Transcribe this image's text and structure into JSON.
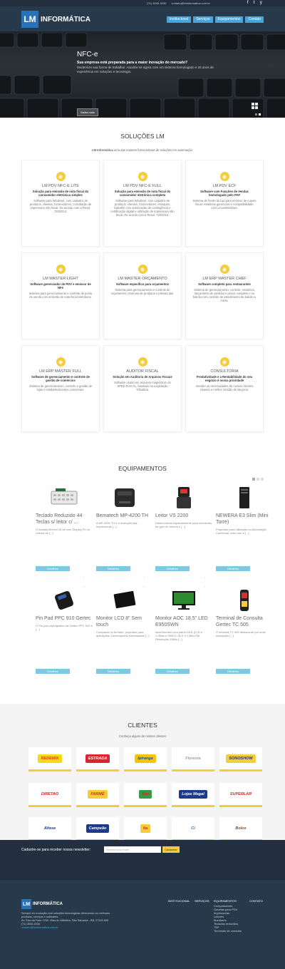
{
  "topbar": {
    "phone": "(71) 3040-4030",
    "email": "contato@lminformatica.com.br",
    "social": [
      "f",
      "t",
      "y"
    ]
  },
  "header": {
    "logo_mark": "LM",
    "logo_text": "INFORMÁTICA",
    "nav": [
      "Institucional",
      "Serviços",
      "Equipamentos",
      "Contato"
    ]
  },
  "hero": {
    "title": "NFC-e",
    "subtitle": "Sua empresa está preparada para a maior inovação do mercado?",
    "text": "Modernize sua forma de trabalhar. Atualize-se agora com um sistema homologado e 25 anos de experiência em soluções e tecnologia.",
    "button": "Saiba mais"
  },
  "solutions": {
    "title": "SOLUÇÕES LM",
    "subtitle_brand": "LM Informática",
    "subtitle_rest": " uma das maiores fornecedoras de soluções em automação.",
    "items": [
      {
        "name": "LM PDV NFC-E LITE",
        "headline": "Solução para emissão de nota fiscal do consumidor eletrônica simples",
        "desc": "Software para Windows, com cadastro de produtos, clientes, fornecedores, conciliação de impressora não fiscal. De acordo com a Resol. 720/2014."
      },
      {
        "name": "LM PDV NFC-E FULL",
        "headline": "Solução para emissão de nota fiscal do consumidor eletrônica completa",
        "desc": "Software para Windows, com cadastro de produtos, clientes, fornecedores, estoques, trabalhe com autorização de contingência e certificação digital e utilização de impressora não fiscal. De acordo com a Resol. 720/2014."
      },
      {
        "name": "LM PDV ECF",
        "headline": "Software com Funções de Vendas homologado pelo PAF",
        "desc": "Sistema de frente de loja para emissor de cupom fiscal, relatórios gerenciais e compatibilidade com Linux/Windows."
      },
      {
        "name": "LM MASTER LIGHT",
        "headline": "Software gerenciador de PDV e emissor de NFe",
        "desc": "Sistema para gerenciamento e controle de ponto de venda com emissão de nota fiscal eletrônica."
      },
      {
        "name": "LM MASTER ORÇAMENTO",
        "headline": "Software específico para orçamentos",
        "desc": "Sistema para gerenciamento e controle de orçamentos, reservas de produtos e prévias das."
      },
      {
        "name": "LM ERP MASTER CHEF",
        "headline": "Software completo para restaurantes",
        "desc": "Sistema de gerenciamento, controle, relatórios, lançamento de pedidos e pesos completo e no balcão com controle de atendimento de balcão e mesa."
      },
      {
        "name": "LM ERP MASTER FULL",
        "headline": "Software de gerenciamento e controle de gestão de comércios",
        "desc": "Sistema de gerenciamento, controle e gestão de lojas e estabelecimentos comerciais."
      },
      {
        "name": "AUDITOR FISCAL",
        "headline": "Solução em Auditoria de Arquivos Fiscais",
        "desc": "Software usado em arquivos magnéticos do SPED FISCAL, baseado na Legislação Tributária."
      },
      {
        "name": "CONSULTORIA",
        "headline": "Produtividade e a Rentabilidade do seu negócio é nossa prioridade",
        "desc": "Atender as necessidades de nossos clientes visando a melhor Gestão de Negócio."
      }
    ]
  },
  "equipment": {
    "title": "EQUIPAMENTOS",
    "button": "Detalhes",
    "items": [
      {
        "name": "Teclado Reduzido 44 Teclas s/ leitor c/ ...",
        "desc": "O teclado flexível 44 de com Display Pb no Leitura de [...]",
        "icon": "keyboard-icon"
      },
      {
        "name": "Bematech MP-4200 TH",
        "desc": "A MP-4200 TH é a evolução das impressoras [...]",
        "icon": "printer-icon"
      },
      {
        "name": "Leitor VS 2200",
        "desc": "Desenvolvido especialmente para checkouts de giro de volume e [...]",
        "icon": "scanner-icon"
      },
      {
        "name": "NEWERA E3 Slim (Mini Torre)",
        "desc": "Projetado para utilização na Automação Comercial, este com a [...]",
        "icon": "tower-icon"
      },
      {
        "name": "Pin Pad PPC 910 Gertec",
        "desc": "O Pin pad criptográfico da Gertec PPC 910 é [...]",
        "icon": "pinpad-icon"
      },
      {
        "name": "Monitor LCD 8\" Sem touch",
        "desc": "Compacto no formato, projetado para aplicações. Desempenho interessante [...]",
        "icon": "monitor-small-icon"
      },
      {
        "name": "Monitor AOC 18,5\" LED E950SWN",
        "desc": "Ideal Monitor com painel LED (LCD e 1,35ms e 5000:1 18,5\" e 1366x768, Resolução 1366x [...]",
        "icon": "monitor-icon"
      },
      {
        "name": "Terminal de Consulta Gertec TC 505",
        "desc": "O terminal TC 505 destaca-se por suas inovações [...]",
        "icon": "terminal-icon"
      }
    ]
  },
  "clients": {
    "title": "CLIENTES",
    "subtitle": "Conheça alguns de nossos clientes",
    "logos": [
      {
        "text": "REDEMIX",
        "color": "#e53b2b",
        "bg": "#f7d917"
      },
      {
        "text": "ESTRADA",
        "color": "#ffffff",
        "bg": "#d9262e"
      },
      {
        "text": "Ipiranga",
        "color": "#1b4da0",
        "bg": "#f5c600"
      },
      {
        "text": "Floresta",
        "color": "#9aa1a9",
        "bg": "#ffffff"
      },
      {
        "text": "SONOSHOW",
        "color": "#2a2e7d",
        "bg": "#f5cd3b"
      },
      {
        "text": "DIRETAO",
        "color": "#d9262e",
        "bg": "#ffffff"
      },
      {
        "text": "FARMÉ",
        "color": "#d9262e",
        "bg": "#f5cd3b"
      },
      {
        "text": "Sim",
        "color": "#d9262e",
        "bg": "#2f9e44"
      },
      {
        "text": "Lojas Magal",
        "color": "#ffffff",
        "bg": "#1c3a8a"
      },
      {
        "text": "SUPERLAR",
        "color": "#d9262e",
        "bg": "#ffffff"
      },
      {
        "text": "Altese",
        "color": "#1c3a8a",
        "bg": "#ffffff"
      },
      {
        "text": "Campeão",
        "color": "#ffffff",
        "bg": "#1c3a8a"
      },
      {
        "text": "Ita",
        "color": "#d9262e",
        "bg": "#f5cd3b"
      },
      {
        "text": "Ci",
        "color": "#1c6fd1",
        "bg": "#ffffff"
      },
      {
        "text": "Bolos",
        "color": "#7a4b2a",
        "bg": "#ffffff"
      }
    ]
  },
  "newsletter": {
    "label": "Cadastre-se para receber nossa newsletter:",
    "placeholder": "Informe seu email",
    "button": "Cadastrar"
  },
  "footer": {
    "logo_mark": "LM",
    "logo_text": "INFORMÁTICA",
    "about": "Sempre em evolução com soluções tecnológicas oferecendo os melhores produtos, serviços e softwares.",
    "address": "Av. Eixo da Fase 1782, Vilas do Atlântico, São Salvador - BA, 27119-505",
    "phone": "(71) 3040-4030",
    "email": "contato@lminformatica.com.br",
    "col_institucional": "INSTITUCIONAL",
    "col_servicos": "SERVIÇOS",
    "col_equipamentos": "EQUIPAMENTOS",
    "col_contato": "CONTATO",
    "equip_links": [
      "Computadores",
      "Gavetas para PDV",
      "Impressoras",
      "Leitores",
      "Monitores",
      "Teclados reduzidos",
      "TEF",
      "Terminais de consulta"
    ]
  },
  "colors": {
    "accent": "#4aa3d9",
    "yellow": "#f5cd3b",
    "dark": "#273a4c"
  }
}
